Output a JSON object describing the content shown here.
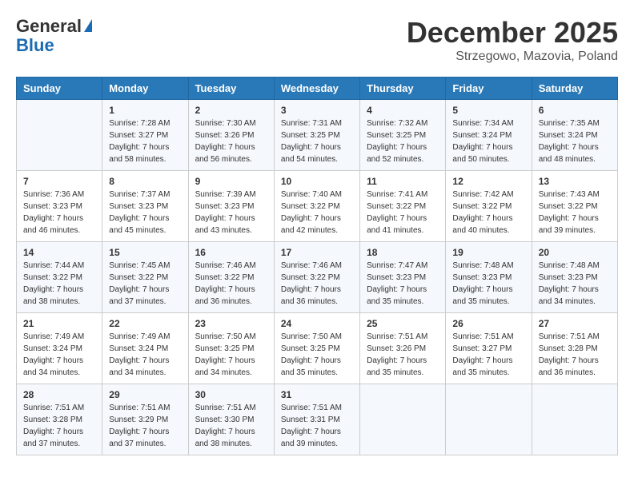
{
  "header": {
    "logo_line1": "General",
    "logo_line2": "Blue",
    "month": "December 2025",
    "location": "Strzegowo, Mazovia, Poland"
  },
  "weekdays": [
    "Sunday",
    "Monday",
    "Tuesday",
    "Wednesday",
    "Thursday",
    "Friday",
    "Saturday"
  ],
  "weeks": [
    [
      {
        "day": "",
        "sunrise": "",
        "sunset": "",
        "daylight": ""
      },
      {
        "day": "1",
        "sunrise": "Sunrise: 7:28 AM",
        "sunset": "Sunset: 3:27 PM",
        "daylight": "Daylight: 7 hours and 58 minutes."
      },
      {
        "day": "2",
        "sunrise": "Sunrise: 7:30 AM",
        "sunset": "Sunset: 3:26 PM",
        "daylight": "Daylight: 7 hours and 56 minutes."
      },
      {
        "day": "3",
        "sunrise": "Sunrise: 7:31 AM",
        "sunset": "Sunset: 3:25 PM",
        "daylight": "Daylight: 7 hours and 54 minutes."
      },
      {
        "day": "4",
        "sunrise": "Sunrise: 7:32 AM",
        "sunset": "Sunset: 3:25 PM",
        "daylight": "Daylight: 7 hours and 52 minutes."
      },
      {
        "day": "5",
        "sunrise": "Sunrise: 7:34 AM",
        "sunset": "Sunset: 3:24 PM",
        "daylight": "Daylight: 7 hours and 50 minutes."
      },
      {
        "day": "6",
        "sunrise": "Sunrise: 7:35 AM",
        "sunset": "Sunset: 3:24 PM",
        "daylight": "Daylight: 7 hours and 48 minutes."
      }
    ],
    [
      {
        "day": "7",
        "sunrise": "Sunrise: 7:36 AM",
        "sunset": "Sunset: 3:23 PM",
        "daylight": "Daylight: 7 hours and 46 minutes."
      },
      {
        "day": "8",
        "sunrise": "Sunrise: 7:37 AM",
        "sunset": "Sunset: 3:23 PM",
        "daylight": "Daylight: 7 hours and 45 minutes."
      },
      {
        "day": "9",
        "sunrise": "Sunrise: 7:39 AM",
        "sunset": "Sunset: 3:23 PM",
        "daylight": "Daylight: 7 hours and 43 minutes."
      },
      {
        "day": "10",
        "sunrise": "Sunrise: 7:40 AM",
        "sunset": "Sunset: 3:22 PM",
        "daylight": "Daylight: 7 hours and 42 minutes."
      },
      {
        "day": "11",
        "sunrise": "Sunrise: 7:41 AM",
        "sunset": "Sunset: 3:22 PM",
        "daylight": "Daylight: 7 hours and 41 minutes."
      },
      {
        "day": "12",
        "sunrise": "Sunrise: 7:42 AM",
        "sunset": "Sunset: 3:22 PM",
        "daylight": "Daylight: 7 hours and 40 minutes."
      },
      {
        "day": "13",
        "sunrise": "Sunrise: 7:43 AM",
        "sunset": "Sunset: 3:22 PM",
        "daylight": "Daylight: 7 hours and 39 minutes."
      }
    ],
    [
      {
        "day": "14",
        "sunrise": "Sunrise: 7:44 AM",
        "sunset": "Sunset: 3:22 PM",
        "daylight": "Daylight: 7 hours and 38 minutes."
      },
      {
        "day": "15",
        "sunrise": "Sunrise: 7:45 AM",
        "sunset": "Sunset: 3:22 PM",
        "daylight": "Daylight: 7 hours and 37 minutes."
      },
      {
        "day": "16",
        "sunrise": "Sunrise: 7:46 AM",
        "sunset": "Sunset: 3:22 PM",
        "daylight": "Daylight: 7 hours and 36 minutes."
      },
      {
        "day": "17",
        "sunrise": "Sunrise: 7:46 AM",
        "sunset": "Sunset: 3:22 PM",
        "daylight": "Daylight: 7 hours and 36 minutes."
      },
      {
        "day": "18",
        "sunrise": "Sunrise: 7:47 AM",
        "sunset": "Sunset: 3:23 PM",
        "daylight": "Daylight: 7 hours and 35 minutes."
      },
      {
        "day": "19",
        "sunrise": "Sunrise: 7:48 AM",
        "sunset": "Sunset: 3:23 PM",
        "daylight": "Daylight: 7 hours and 35 minutes."
      },
      {
        "day": "20",
        "sunrise": "Sunrise: 7:48 AM",
        "sunset": "Sunset: 3:23 PM",
        "daylight": "Daylight: 7 hours and 34 minutes."
      }
    ],
    [
      {
        "day": "21",
        "sunrise": "Sunrise: 7:49 AM",
        "sunset": "Sunset: 3:24 PM",
        "daylight": "Daylight: 7 hours and 34 minutes."
      },
      {
        "day": "22",
        "sunrise": "Sunrise: 7:49 AM",
        "sunset": "Sunset: 3:24 PM",
        "daylight": "Daylight: 7 hours and 34 minutes."
      },
      {
        "day": "23",
        "sunrise": "Sunrise: 7:50 AM",
        "sunset": "Sunset: 3:25 PM",
        "daylight": "Daylight: 7 hours and 34 minutes."
      },
      {
        "day": "24",
        "sunrise": "Sunrise: 7:50 AM",
        "sunset": "Sunset: 3:25 PM",
        "daylight": "Daylight: 7 hours and 35 minutes."
      },
      {
        "day": "25",
        "sunrise": "Sunrise: 7:51 AM",
        "sunset": "Sunset: 3:26 PM",
        "daylight": "Daylight: 7 hours and 35 minutes."
      },
      {
        "day": "26",
        "sunrise": "Sunrise: 7:51 AM",
        "sunset": "Sunset: 3:27 PM",
        "daylight": "Daylight: 7 hours and 35 minutes."
      },
      {
        "day": "27",
        "sunrise": "Sunrise: 7:51 AM",
        "sunset": "Sunset: 3:28 PM",
        "daylight": "Daylight: 7 hours and 36 minutes."
      }
    ],
    [
      {
        "day": "28",
        "sunrise": "Sunrise: 7:51 AM",
        "sunset": "Sunset: 3:28 PM",
        "daylight": "Daylight: 7 hours and 37 minutes."
      },
      {
        "day": "29",
        "sunrise": "Sunrise: 7:51 AM",
        "sunset": "Sunset: 3:29 PM",
        "daylight": "Daylight: 7 hours and 37 minutes."
      },
      {
        "day": "30",
        "sunrise": "Sunrise: 7:51 AM",
        "sunset": "Sunset: 3:30 PM",
        "daylight": "Daylight: 7 hours and 38 minutes."
      },
      {
        "day": "31",
        "sunrise": "Sunrise: 7:51 AM",
        "sunset": "Sunset: 3:31 PM",
        "daylight": "Daylight: 7 hours and 39 minutes."
      },
      {
        "day": "",
        "sunrise": "",
        "sunset": "",
        "daylight": ""
      },
      {
        "day": "",
        "sunrise": "",
        "sunset": "",
        "daylight": ""
      },
      {
        "day": "",
        "sunrise": "",
        "sunset": "",
        "daylight": ""
      }
    ]
  ]
}
